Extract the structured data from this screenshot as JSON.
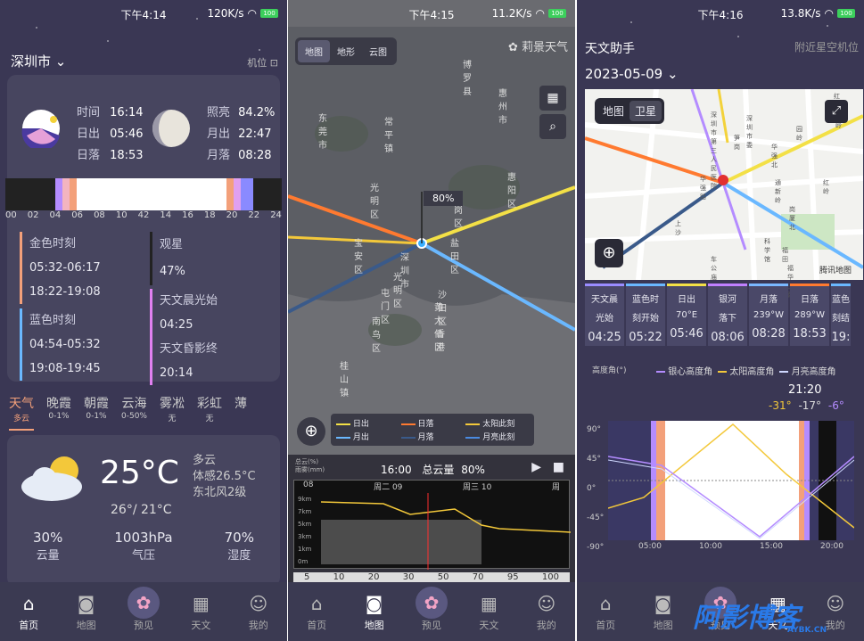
{
  "phone1": {
    "status": {
      "time": "下午4:14",
      "speed": "120K/s",
      "battery": "100"
    },
    "city": "深圳市",
    "locate": "机位",
    "sun": {
      "time_label": "时间",
      "time": "16:14",
      "rise_label": "日出",
      "rise": "05:46",
      "set_label": "日落",
      "set": "18:53"
    },
    "moon": {
      "light_label": "照亮",
      "light": "84.2%",
      "rise_label": "月出",
      "rise": "22:47",
      "set_label": "月落",
      "set": "08:28"
    },
    "timeline_ticks": [
      "00",
      "02",
      "04",
      "06",
      "08",
      "10",
      "42",
      "14",
      "16",
      "18",
      "20",
      "22",
      "24"
    ],
    "golden": {
      "label": "金色时刻",
      "m": "05:32-06:17",
      "e": "18:22-19:08"
    },
    "blue": {
      "label": "蓝色时刻",
      "m": "04:54-05:32",
      "e": "19:08-19:45"
    },
    "seeing": {
      "label": "观星",
      "val": "47%"
    },
    "dawn": {
      "label": "天文晨光始",
      "val": "04:25"
    },
    "dusk": {
      "label": "天文昏影终",
      "val": "20:14"
    },
    "wtabs": [
      {
        "t": "天气",
        "s": "多云"
      },
      {
        "t": "晚霞",
        "s": "0-1%"
      },
      {
        "t": "朝霞",
        "s": "0-1%"
      },
      {
        "t": "云海",
        "s": "0-50%"
      },
      {
        "t": "雾凇",
        "s": "无"
      },
      {
        "t": "彩虹",
        "s": "无"
      },
      {
        "t": "薄",
        "s": ""
      }
    ],
    "weather": {
      "temp": "25°C",
      "cond": "多云",
      "feel": "体感26.5°C",
      "wind": "东北风2级",
      "range": "26°/ 21°C",
      "cloud": "30%",
      "cloud_l": "云量",
      "press": "1003hPa",
      "press_l": "气压",
      "hum": "70%",
      "hum_l": "湿度"
    }
  },
  "phone2": {
    "status": {
      "time": "下午4:15",
      "speed": "11.2K/s",
      "battery": "100"
    },
    "maptabs": [
      "地图",
      "地形",
      "云图"
    ],
    "logo": "莉景天气",
    "places": [
      "博罗县",
      "惠州市",
      "东莞市",
      "常平镇",
      "惠阳区",
      "光明区",
      "龙岗区",
      "宝安区",
      "深圳市",
      "盐田区",
      "光明区",
      "屯门区",
      "沙田区",
      "黄大仙区",
      "南鸟区",
      "香港",
      "桂山镇"
    ],
    "flag": "80%",
    "legend": [
      "日出",
      "日落",
      "太阳此刻",
      "月出",
      "月落",
      "月亮此刻"
    ],
    "bar": {
      "l1": "总云(%)",
      "l2": "雨雾(mm)",
      "time": "16:00",
      "total": "总云量",
      "val": "80%"
    },
    "days": [
      "08",
      "周二 09",
      "周三 10",
      "周"
    ],
    "alts": [
      "9km",
      "7km",
      "5km",
      "3km",
      "1km",
      "0m"
    ],
    "scale": [
      "5",
      "10",
      "20",
      "30",
      "50",
      "70",
      "95",
      "100"
    ]
  },
  "phone3": {
    "status": {
      "time": "下午4:16",
      "speed": "13.8K/s",
      "battery": "100"
    },
    "title": "天文助手",
    "near": "附近星空机位",
    "date": "2023-05-09",
    "mapbtns": [
      "地图",
      "卫星"
    ],
    "maplogo": "腾讯地图",
    "mapplaces": [
      "红岭站",
      "深圳市第三人民医院",
      "深圳市委",
      "园岭",
      "八卦岭",
      "笋岗",
      "华强北",
      "通新岭",
      "红岭",
      "华强路",
      "岗厦北",
      "上沙",
      "科学馆",
      "福田",
      "车公庙",
      "福华三路"
    ],
    "cols": [
      {
        "h1": "天文晨",
        "h2": "光始",
        "v": "04:25",
        "c": "#9a8cff"
      },
      {
        "h1": "蓝色时",
        "h2": "刻开始",
        "v": "05:22",
        "c": "#6ab8ff"
      },
      {
        "h1": "日出",
        "h2": "70°E",
        "v": "05:46",
        "c": "#f3e046"
      },
      {
        "h1": "银河",
        "h2": "落下",
        "v": "08:06",
        "c": "#c080ff"
      },
      {
        "h1": "月落",
        "h2": "239°W",
        "v": "08:28",
        "c": "#7ab8ff"
      },
      {
        "h1": "日落",
        "h2": "289°W",
        "v": "18:53",
        "c": "#ff7a30"
      },
      {
        "h1": "蓝色",
        "h2": "刻结",
        "v": "19:",
        "c": "#6ab8ff"
      }
    ],
    "chart": {
      "ylabel": "高度角(°)",
      "legend": [
        "银心高度角",
        "太阳高度角",
        "月亮高度角"
      ],
      "time": "21:20",
      "a": "-31°",
      "b": "-17°",
      "c": "-6°",
      "yticks": [
        "90°",
        "45°",
        "0°",
        "-45°",
        "-90°"
      ],
      "xticks": [
        "05:00",
        "10:00",
        "15:00",
        "20:00"
      ]
    },
    "watermark": "阿影博客",
    "watermark2": "AYBK.CN"
  },
  "tabs": {
    "home": "首页",
    "map": "地图",
    "preview": "预见",
    "astro": "天文",
    "me": "我的"
  },
  "colors": {
    "bg": "#3a3754",
    "card": "#47455f",
    "golden": "#f3a07a",
    "blue": "#6ab8ff",
    "purple": "#c080ff"
  }
}
